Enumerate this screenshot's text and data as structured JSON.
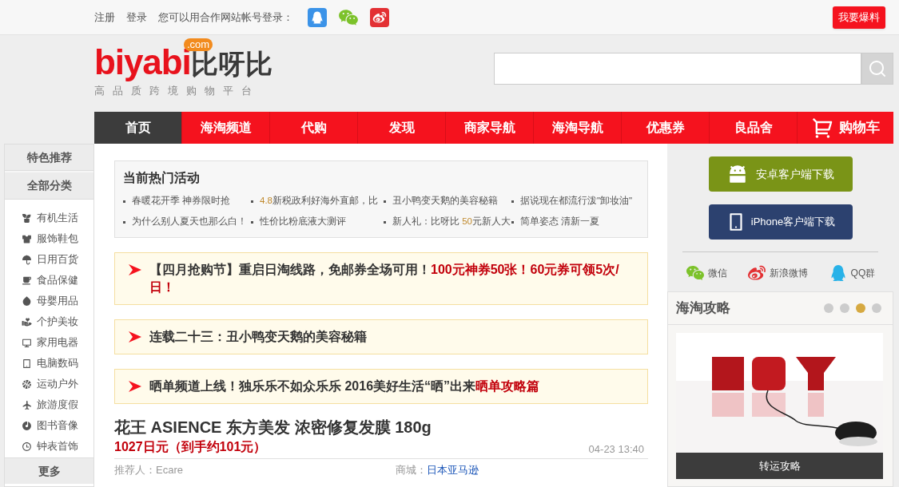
{
  "top_bar": {
    "links": [
      "注册",
      "登录"
    ],
    "login_prompt": "您可以用合作网站帐号登录：",
    "report_button": "我要爆料"
  },
  "logo": {
    "wordmark": "biyabi",
    "domain": ".com",
    "chinese_name": "比呀比",
    "tagline": "高品质跨境购物平台"
  },
  "nav": [
    {
      "label": "首页",
      "selected": true
    },
    {
      "label": "海淘频道",
      "selected": false
    },
    {
      "label": "代购",
      "selected": false
    },
    {
      "label": "发现",
      "selected": false
    },
    {
      "label": "商家导航",
      "selected": false
    },
    {
      "label": "海淘导航",
      "selected": false
    },
    {
      "label": "优惠券",
      "selected": false
    },
    {
      "label": "良品舍",
      "selected": false
    }
  ],
  "cart_link": "购物车",
  "sidebar": {
    "featured": "特色推荐",
    "all_categories": "全部分类",
    "categories": [
      "有机生活",
      "服饰鞋包",
      "日用百货",
      "食品保健",
      "母婴用品",
      "个护美妆",
      "家用电器",
      "电脑数码",
      "运动户外",
      "旅游度假",
      "图书音像",
      "钟表首饰"
    ],
    "more": "更多"
  },
  "hot_activities": {
    "title": "当前热门活动",
    "items": [
      {
        "parts": [
          {
            "text": "春暖花开季 神券限时抢",
            "highlight": false
          }
        ]
      },
      {
        "parts": [
          {
            "text": "4.8",
            "highlight": true
          },
          {
            "text": "新税政利好海外直邮，比",
            "highlight": false
          }
        ]
      },
      {
        "parts": [
          {
            "text": "丑小鸭变天鹅的美容秘籍",
            "highlight": false
          }
        ]
      },
      {
        "parts": [
          {
            "text": "据说现在都流行泼\"卸妆油\"",
            "highlight": false
          }
        ]
      },
      {
        "parts": [
          {
            "text": "为什么别人夏天也那么白！",
            "highlight": false
          }
        ]
      },
      {
        "parts": [
          {
            "text": "性价比粉底液大测评",
            "highlight": false
          }
        ]
      },
      {
        "parts": [
          {
            "text": "新人礼：比呀比 ",
            "highlight": false
          },
          {
            "text": "50",
            "highlight": true
          },
          {
            "text": "元新人大",
            "highlight": false
          }
        ]
      },
      {
        "parts": [
          {
            "text": "简单姿态 清新一夏",
            "highlight": false
          }
        ]
      }
    ]
  },
  "notices": [
    {
      "parts": [
        {
          "text": "【四月抢购节】重启日淘线路，免邮券全场可用！",
          "highlight": false
        },
        {
          "text": "100元神券50张！60元券可领5次/日！",
          "highlight": true
        }
      ]
    },
    {
      "parts": [
        {
          "text": "连载二十三：丑小鸭变天鹅的美容秘籍",
          "highlight": false
        }
      ]
    },
    {
      "parts": [
        {
          "text": "晒单频道上线！独乐乐不如众乐乐 2016美好生活“晒”出来",
          "highlight": false
        },
        {
          "text": "晒单攻略篇",
          "highlight": true
        }
      ]
    }
  ],
  "product": {
    "title": "花王 ASIENCE 东方美发 浓密修复发膜 180g",
    "price": "1027日元（到手约101元）",
    "time": "04-23 13:40",
    "recommender_label": "推荐人：",
    "recommender": "Ecare",
    "store_label": "商城：",
    "store": "日本亚马逊"
  },
  "apps": {
    "android_button": "安卓客户端下载",
    "iphone_button": "iPhone客户端下载"
  },
  "social": [
    "微信",
    "新浪微博",
    "QQ群"
  ],
  "guide": {
    "title": "海淘攻略",
    "dots": [
      {
        "selected": false
      },
      {
        "selected": false
      },
      {
        "selected": true
      },
      {
        "selected": false
      }
    ],
    "caption": "转运攻略"
  }
}
